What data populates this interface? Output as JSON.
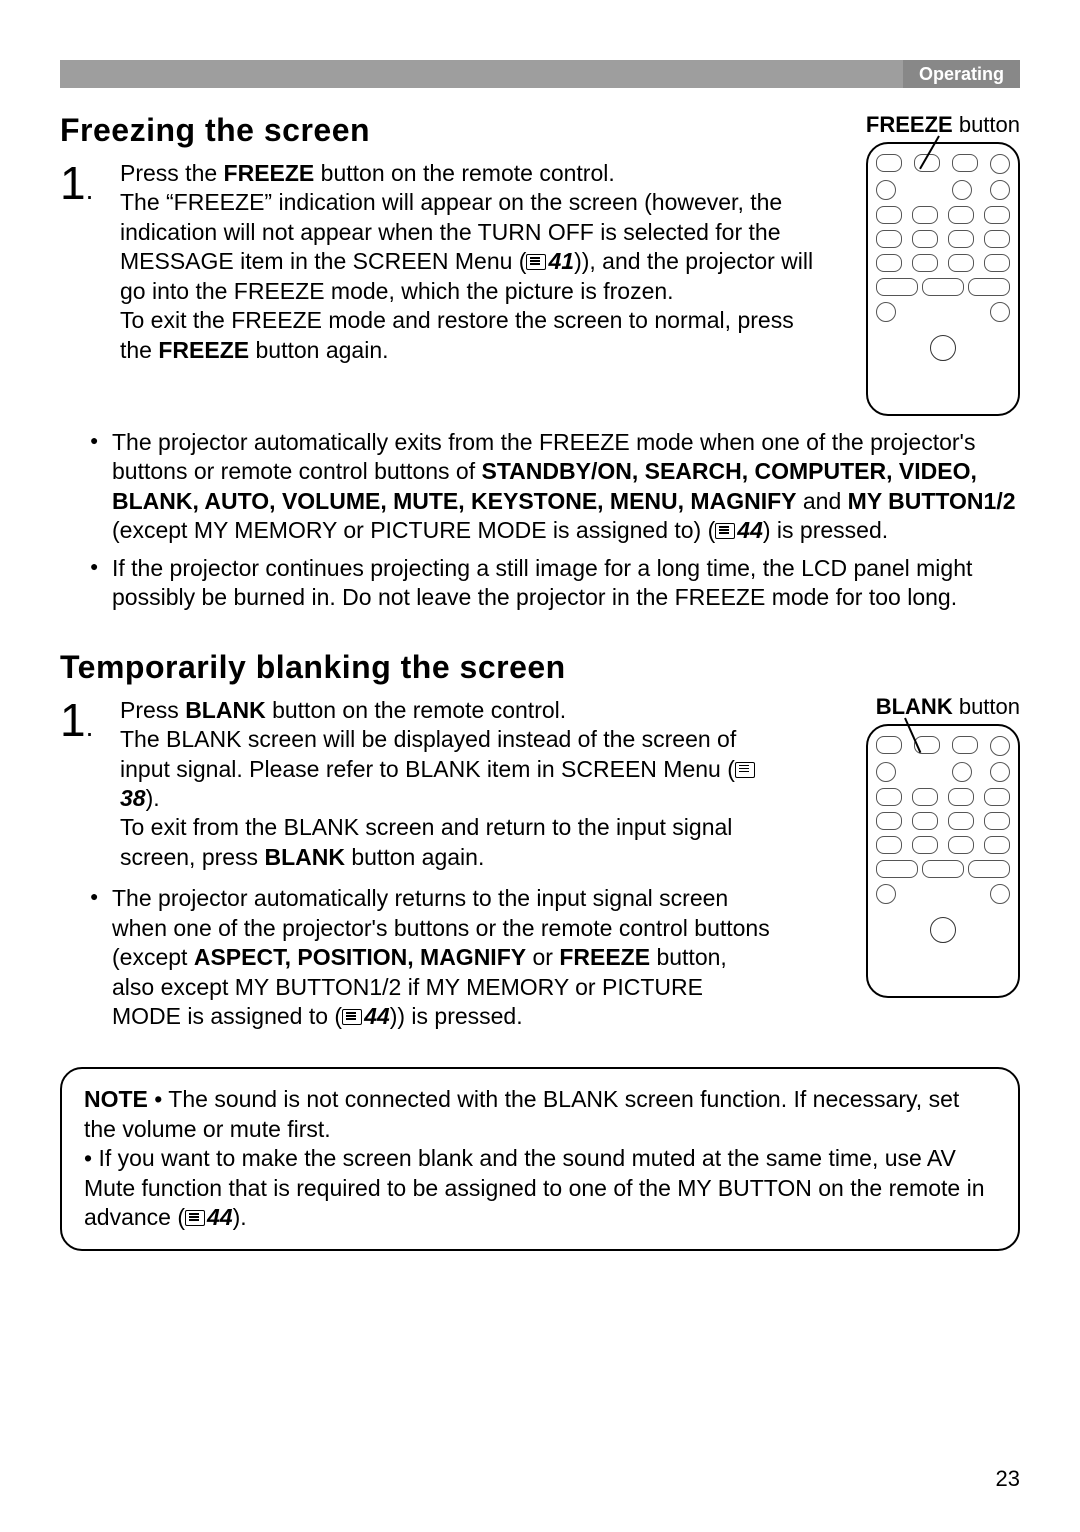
{
  "header": {
    "section_label": "Operating"
  },
  "freeze": {
    "heading": "Freezing the screen",
    "remote_label_prefix": "FREEZE",
    "remote_label_suffix": " button",
    "step1_a": "Press the ",
    "step1_b": "FREEZE",
    "step1_c": " button on the remote control.",
    "step1_d": "The “FREEZE” indication will appear on the screen (however, the indication will not appear when the TURN OFF is selected for the MESSAGE item in the SCREEN Menu (",
    "ref1": "41",
    "step1_e": ")), and the projector will go into the FREEZE mode, which the picture is frozen.",
    "step1_f": "To exit the FREEZE mode and restore the screen to normal, press the ",
    "step1_g": "FREEZE",
    "step1_h": " button again.",
    "bullet1_a": "The projector automatically exits from the FREEZE mode when one of the projector's buttons or remote control buttons of ",
    "bullet1_b": "STANDBY/ON, SEARCH, COMPUTER, VIDEO, BLANK, AUTO, VOLUME, MUTE, KEYSTONE, MENU, MAGNIFY",
    "bullet1_c": " and ",
    "bullet1_d": "MY BUTTON1/2",
    "bullet1_e": " (except MY MEMORY or PICTURE MODE is assigned to) (",
    "ref2": "44",
    "bullet1_f": ") is pressed.",
    "bullet2": "If the projector continues projecting a still image for a long time, the LCD panel might possibly be burned in. Do not leave the projector in the FREEZE mode for too long."
  },
  "blank": {
    "heading": "Temporarily blanking the screen",
    "remote_label_prefix": "BLANK",
    "remote_label_suffix": " button",
    "step1_a": "Press ",
    "step1_b": "BLANK",
    "step1_c": " button on the remote control.",
    "step1_d": "The BLANK screen will be displayed instead of the screen of input signal. Please refer to BLANK item in SCREEN Menu (",
    "ref1": "38",
    "step1_e": ").",
    "step1_f": "To exit from the BLANK screen and return to the input signal screen, press ",
    "step1_g": "BLANK",
    "step1_h": " button again.",
    "bullet1_a": "The projector automatically returns to the input signal screen when one of the projector's buttons or the remote control buttons (except ",
    "bullet1_b": "ASPECT, POSITION, MAGNIFY",
    "bullet1_c": " or ",
    "bullet1_d": "FREEZE",
    "bullet1_e": " button, also except MY BUTTON1/2 if MY MEMORY or PICTURE MODE is assigned to (",
    "ref2": "44",
    "bullet1_f": ")) is pressed."
  },
  "note": {
    "label": "NOTE",
    "line1": "  • The sound is not connected with the BLANK screen function. If necessary, set the volume or mute first.",
    "line2_a": "• If you want to make the screen blank and the sound muted at the same time, use AV Mute function that is required to be assigned to one of the MY BUTTON on the remote in advance (",
    "ref": "44",
    "line2_b": ")."
  },
  "page_number": "23"
}
